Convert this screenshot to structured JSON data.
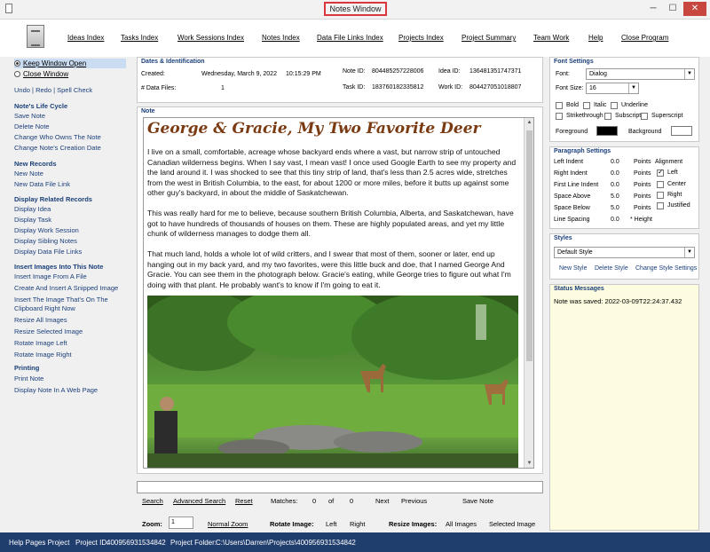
{
  "window": {
    "title": "Notes Window",
    "min": "─",
    "max": "☐",
    "close": "✕"
  },
  "menu": [
    "Ideas Index",
    "Tasks Index",
    "Work Sessions Index",
    "Notes Index",
    "Data File Links Index",
    "Projects Index",
    "Project Summary",
    "Team Work",
    "Help",
    "Close Program"
  ],
  "left": {
    "keep_open": "Keep Window Open",
    "close_window": "Close Window",
    "undo": "Undo",
    "redo": "Redo",
    "spell": "Spell Check",
    "sections": [
      {
        "heading": "Note's Life Cycle",
        "items": [
          "Save Note",
          "Delete Note",
          "Change Who Owns The Note",
          "Change Note's Creation Date"
        ]
      },
      {
        "heading": "New Records",
        "items": [
          "New Note",
          "New Data File Link"
        ]
      },
      {
        "heading": "Display Related Records",
        "items": [
          "Display Idea",
          "Display Task",
          "Display Work Session",
          "Display Sibling Notes",
          "Display Data File Links"
        ]
      },
      {
        "heading": "Insert Images Into This Note",
        "items": [
          "Insert Image From A File",
          "Create And Insert A Snipped Image",
          "Insert The Image That's On The Clipboard Right Now",
          "Resize All Images",
          "Resize Selected Image",
          "Rotate Image Left",
          "Rotate Image Right"
        ]
      },
      {
        "heading": "Printing",
        "items": [
          "Print Note",
          "Display Note In A Web Page"
        ]
      }
    ]
  },
  "dates": {
    "title": "Dates & Identification",
    "created_label": "Created:",
    "created_value": "Wednesday, March 9, 2022",
    "created_time": "10:15:29 PM",
    "files_label": "# Data Files:",
    "files_value": "1",
    "note_id_label": "Note ID:",
    "note_id": "804485257228006",
    "task_id_label": "Task ID:",
    "task_id": "183760182335812",
    "idea_id_label": "Idea ID:",
    "idea_id": "136481351747371",
    "work_id_label": "Work ID:",
    "work_id": "804427051018807"
  },
  "note": {
    "label": "Note",
    "title": "George & Gracie, My Two Favorite Deer",
    "p1": "I live on a small, comfortable, acreage whose backyard ends where a vast, but narrow strip of untouched Canadian wilderness begins. When I say vast, I mean vast! I once used Google Earth to see my property and the land around it. I was shocked to see that this tiny strip of land, that's less than 2.5 acres wide, stretches from the west in British Columbia, to the east, for about 1200 or more miles, before it butts up against some other guy's backyard, in about the middle of Saskatchewan.",
    "p2": "This was really hard for me to believe, because southern British Columbia, Alberta, and Saskatchewan, have got to have hundreds of thousands of houses on them. These are highly populated areas, and yet my little chunk of wilderness manages to dodge them all.",
    "p3": "That much land, holds a whole lot of wild critters, and I swear that most of them, sooner or later, end up hanging out in my back yard, and my two favorites, were this little buck and doe, that I named George And Gracie. You can see them in the photograph below. Gracie's eating, while George tries to figure out what I'm doing with that plant. He probably want's to know if I'm going to eat it."
  },
  "search": {
    "search": "Search",
    "advanced": "Advanced Search",
    "reset": "Reset",
    "matches_label": "Matches:",
    "matches": "0",
    "of": "of",
    "total": "0",
    "next": "Next",
    "previous": "Previous",
    "save": "Save Note"
  },
  "zoom": {
    "label": "Zoom:",
    "value": "1",
    "normal": "Normal Zoom",
    "rotate_label": "Rotate Image:",
    "left": "Left",
    "right": "Right",
    "resize_label": "Resize Images:",
    "all": "All Images",
    "selected": "Selected Image"
  },
  "font": {
    "title": "Font Settings",
    "font_label": "Font:",
    "font_value": "Dialog",
    "size_label": "Font Size:",
    "size_value": "16",
    "bold": "Bold",
    "italic": "Italic",
    "underline": "Underline",
    "strike": "Strikethrough",
    "subscript": "Subscript",
    "superscript": "Superscript",
    "fg": "Foreground",
    "bg": "Background",
    "fg_color": "#000000",
    "bg_color": "#ffffff"
  },
  "para": {
    "title": "Paragraph Settings",
    "rows": [
      {
        "label": "Left Indent",
        "value": "0.0",
        "unit": "Points"
      },
      {
        "label": "Right Indent",
        "value": "0.0",
        "unit": "Points"
      },
      {
        "label": "First Line Indent",
        "value": "0.0",
        "unit": "Points"
      },
      {
        "label": "Space Above",
        "value": "5.0",
        "unit": "Points"
      },
      {
        "label": "Space Below",
        "value": "5.0",
        "unit": "Points"
      },
      {
        "label": "Line Spacing",
        "value": "0.0",
        "unit": "* Height"
      }
    ],
    "alignment": "Alignment",
    "left": "Left",
    "center": "Center",
    "right": "Right",
    "justified": "Justified"
  },
  "styles": {
    "title": "Styles",
    "value": "Default Style",
    "new": "New Style",
    "delete": "Delete Style",
    "change": "Change Style Settings"
  },
  "status_msgs": {
    "title": "Status Messages",
    "message": "Note was saved:  2022-03-09T22:24:37.432"
  },
  "statusbar": {
    "project": "Help Pages Project",
    "project_id_label": "Project ID:",
    "project_id": "400956931534842",
    "folder_label": "Project Folder:",
    "folder": "C:\\Users\\Darren\\Projects\\400956931534842"
  }
}
